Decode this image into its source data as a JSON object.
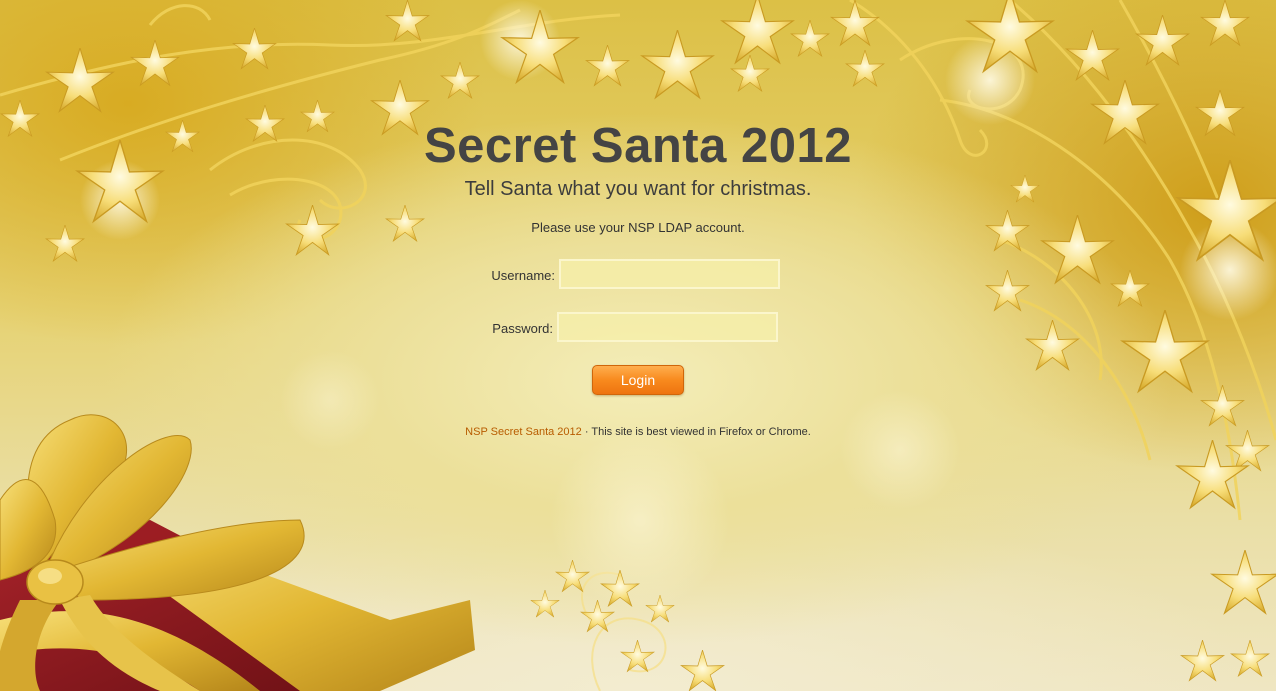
{
  "header": {
    "title": "Secret Santa 2012",
    "subtitle": "Tell Santa what you want for christmas."
  },
  "login": {
    "instructions": "Please use your NSP LDAP account.",
    "username_label": "Username:",
    "username_value": "",
    "password_label": "Password:",
    "password_value": "",
    "submit_label": "Login"
  },
  "footer": {
    "brand": "NSP Secret Santa 2012",
    "separator": " · ",
    "note": "This site is best viewed in Firefox or Chrome."
  },
  "colors": {
    "title": "#444444",
    "button": "#f88a1e",
    "footer_link": "#b85c00",
    "gift_box": "#8b1a1a",
    "ribbon": "#e8c23a"
  },
  "decorations": {
    "background": "gold-stars-swirls",
    "gift": "red-gift-box-with-gold-ribbon-bow"
  }
}
